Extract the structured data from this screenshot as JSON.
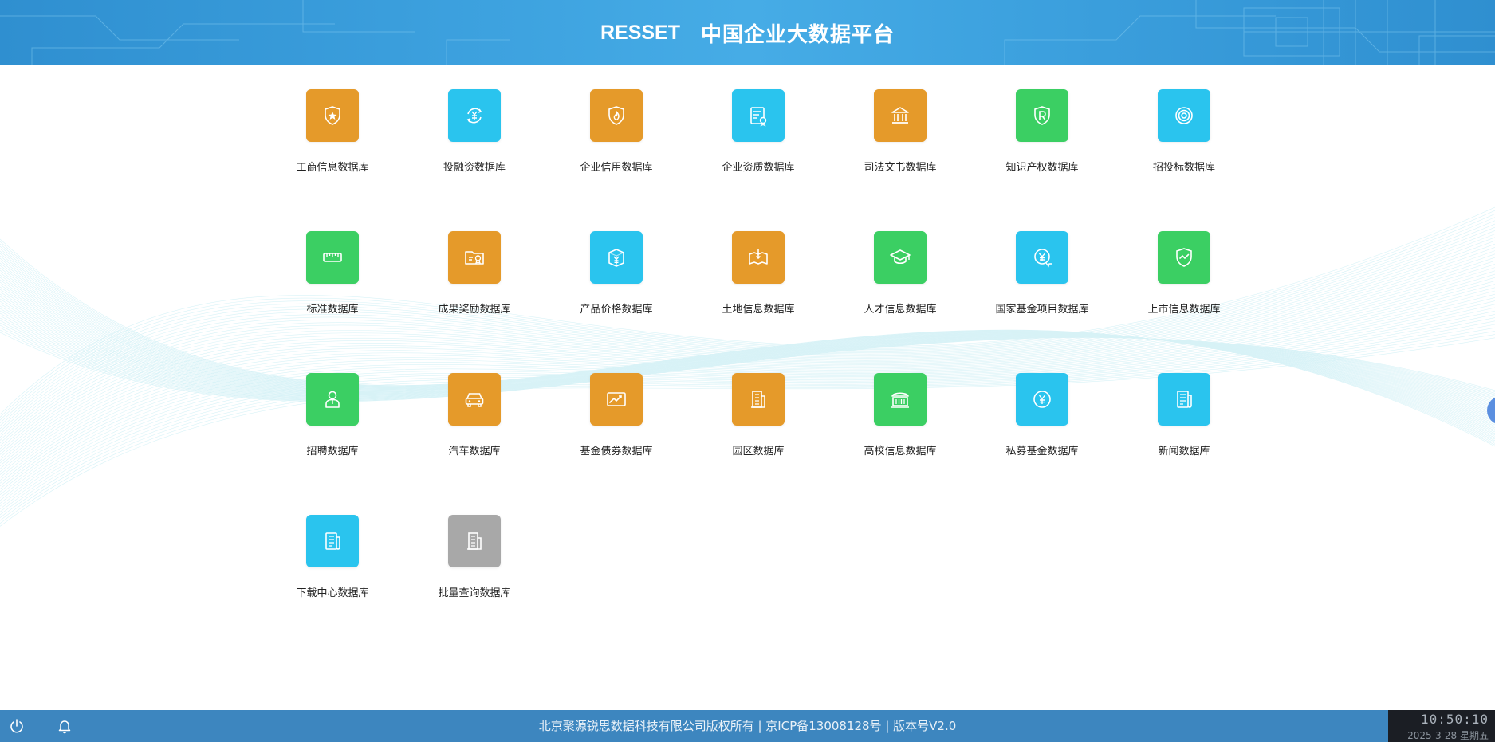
{
  "header": {
    "brand": "RESSET",
    "title": "中国企业大数据平台"
  },
  "tiles": [
    {
      "label": "工商信息数据库",
      "color": "#e59a2a",
      "icon": "shield-star-icon"
    },
    {
      "label": "投融资数据库",
      "color": "#2ac4ee",
      "icon": "yuan-exchange-icon"
    },
    {
      "label": "企业信用数据库",
      "color": "#e59a2a",
      "icon": "shield-flame-icon"
    },
    {
      "label": "企业资质数据库",
      "color": "#2ac4ee",
      "icon": "certificate-icon"
    },
    {
      "label": "司法文书数据库",
      "color": "#e59a2a",
      "icon": "courthouse-icon"
    },
    {
      "label": "知识产权数据库",
      "color": "#3bcf63",
      "icon": "trademark-shield-icon"
    },
    {
      "label": "招投标数据库",
      "color": "#2ac4ee",
      "icon": "target-icon"
    },
    {
      "label": "标准数据库",
      "color": "#3bcf63",
      "icon": "ruler-icon"
    },
    {
      "label": "成果奖励数据库",
      "color": "#e59a2a",
      "icon": "folder-award-icon"
    },
    {
      "label": "产品价格数据库",
      "color": "#2ac4ee",
      "icon": "price-box-icon"
    },
    {
      "label": "土地信息数据库",
      "color": "#e59a2a",
      "icon": "land-map-icon"
    },
    {
      "label": "人才信息数据库",
      "color": "#3bcf63",
      "icon": "graduation-cap-icon"
    },
    {
      "label": "国家基金项目数据库",
      "color": "#2ac4ee",
      "icon": "fund-badge-icon"
    },
    {
      "label": "上市信息数据库",
      "color": "#3bcf63",
      "icon": "shield-check-icon"
    },
    {
      "label": "招聘数据库",
      "color": "#3bcf63",
      "icon": "person-icon"
    },
    {
      "label": "汽车数据库",
      "color": "#e59a2a",
      "icon": "car-icon"
    },
    {
      "label": "基金债券数据库",
      "color": "#e59a2a",
      "icon": "trend-chart-icon"
    },
    {
      "label": "园区数据库",
      "color": "#e59a2a",
      "icon": "building-icon"
    },
    {
      "label": "高校信息数据库",
      "color": "#3bcf63",
      "icon": "university-icon"
    },
    {
      "label": "私募基金数据库",
      "color": "#2ac4ee",
      "icon": "yuan-coin-icon"
    },
    {
      "label": "新闻数据库",
      "color": "#2ac4ee",
      "icon": "newspaper-icon"
    },
    {
      "label": "下载中心数据库",
      "color": "#2ac4ee",
      "icon": "newspaper-icon"
    },
    {
      "label": "批量查询数据库",
      "color": "#a8a8a8",
      "icon": "building-icon"
    }
  ],
  "footer": {
    "copyright": "北京聚源锐思数据科技有限公司版权所有 | 京ICP备13008128号 | 版本号V2.0",
    "time": "10:50:10",
    "date": "2025-3-28 星期五",
    "power_icon": "power-icon",
    "bell_icon": "bell-icon"
  }
}
